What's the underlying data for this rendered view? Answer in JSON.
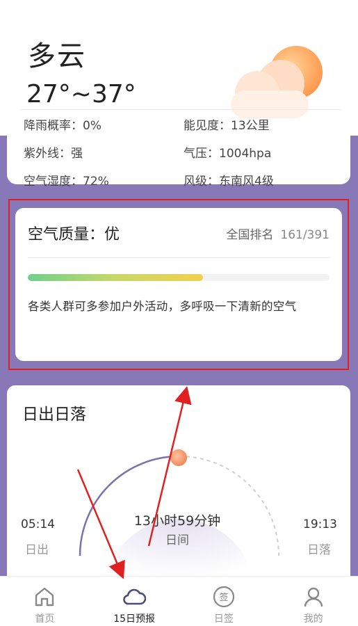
{
  "weather": {
    "condition": "多云",
    "temp_range": "27°~37°",
    "details": [
      {
        "label": "降雨概率：",
        "value": "0%"
      },
      {
        "label": "能见度：",
        "value": "13公里"
      },
      {
        "label": "紫外线：",
        "value": "强"
      },
      {
        "label": "气压：",
        "value": "1004hpa"
      },
      {
        "label": "空气湿度：",
        "value": "72%"
      },
      {
        "label": "风级：",
        "value": "东南风4级"
      }
    ]
  },
  "air_quality": {
    "title": "空气质量：优",
    "rank_label": "全国排名",
    "rank_value": "161/391",
    "level": 0.58,
    "advice": "各类人群可多参加户外活动，多呼吸一下清新的空气"
  },
  "sun": {
    "title": "日出日落",
    "sunrise_time": "05:14",
    "sunrise_label": "日出",
    "sunset_time": "19:13",
    "sunset_label": "日落",
    "day_length": "13小时59分钟",
    "day_label": "日间"
  },
  "nav": {
    "items": [
      {
        "label": "首页",
        "icon": "home-icon"
      },
      {
        "label": "15日预报",
        "icon": "cloud-icon"
      },
      {
        "label": "日签",
        "icon": "sign-icon"
      },
      {
        "label": "我的",
        "icon": "user-icon"
      }
    ],
    "sign_glyph": "签"
  },
  "colors": {
    "accent_purple": "#8878b8",
    "highlight_red": "#e02020",
    "sun_orange": "#f59a6a"
  }
}
